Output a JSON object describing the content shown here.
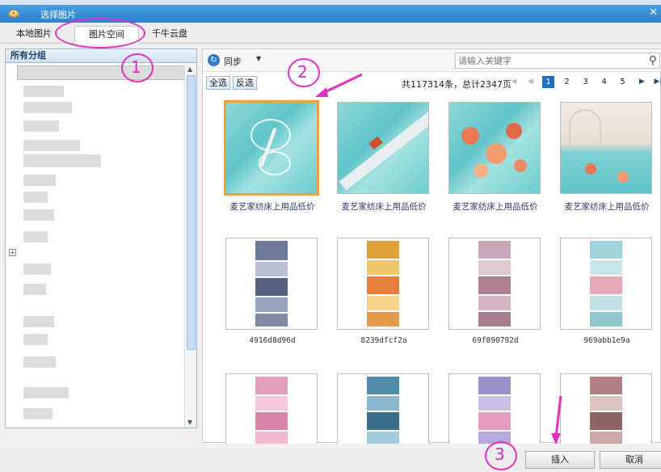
{
  "window": {
    "title": "选择图片",
    "logo_icon": "taobao-logo-icon",
    "close_icon": "close-icon"
  },
  "tabs": [
    {
      "label": "本地图片"
    },
    {
      "label": "图片空间",
      "active": true
    },
    {
      "label": "千牛云盘"
    }
  ],
  "sidebar": {
    "header": "所有分组"
  },
  "toolbar": {
    "sync_label": "同步",
    "search_placeholder": "请输入关键字",
    "select_all": "全选",
    "invert": "反选",
    "count_text": "共117314条，总计2347页",
    "pages": [
      "1",
      "2",
      "3",
      "4",
      "5"
    ],
    "current_page": "1"
  },
  "images": [
    {
      "caption": "麦艺家纺床上用品低价",
      "selected": true
    },
    {
      "caption": "麦艺家纺床上用品低价"
    },
    {
      "caption": "麦艺家纺床上用品低价"
    },
    {
      "caption": "麦艺家纺床上用品低价"
    },
    {
      "caption": "4916d8d96d"
    },
    {
      "caption": "8239dfcf2a"
    },
    {
      "caption": "69f890792d"
    },
    {
      "caption": "969abb1e9a"
    },
    {
      "caption": ""
    },
    {
      "caption": ""
    },
    {
      "caption": ""
    },
    {
      "caption": ""
    }
  ],
  "buttons": {
    "insert": "插入",
    "cancel": "取消"
  },
  "annotations": {
    "n1": "1",
    "n2": "2",
    "n3": "3",
    "color": "#e030c0"
  },
  "colors": {
    "titlebar": "#2b7fcf",
    "selected_border": "#f0a23a",
    "current_page": "#1f6fc0"
  }
}
